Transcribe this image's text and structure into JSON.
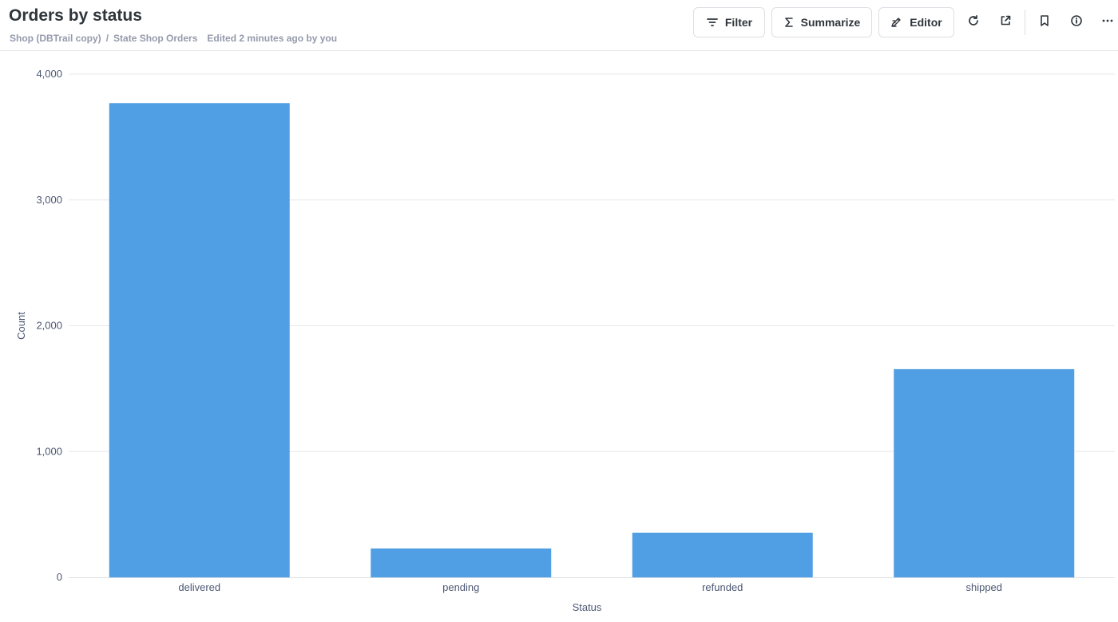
{
  "header": {
    "title": "Orders by status",
    "breadcrumbs": [
      "Shop (DBTrail copy)",
      "State Shop Orders"
    ],
    "breadcrumb_separator": "/",
    "edited": "Edited 2 minutes ago by you"
  },
  "toolbar": {
    "filter_label": "Filter",
    "summarize_label": "Summarize",
    "editor_label": "Editor",
    "icons": [
      "filter-icon",
      "sigma-icon",
      "notebook-icon",
      "refresh-icon",
      "share-icon",
      "bookmark-icon",
      "info-icon",
      "more-icon"
    ]
  },
  "colors": {
    "bar": "#509ee3",
    "grid": "#e6e8eb",
    "text": "#4c5773",
    "title": "#2e353b"
  },
  "chart_data": {
    "type": "bar",
    "categories": [
      "delivered",
      "pending",
      "refunded",
      "shipped"
    ],
    "values": [
      3770,
      230,
      355,
      1655
    ],
    "xlabel": "Status",
    "ylabel": "Count",
    "ylim": [
      0,
      4000
    ],
    "yticks": [
      0,
      1000,
      2000,
      3000,
      4000
    ],
    "ytick_labels": [
      "0",
      "1,000",
      "2,000",
      "3,000",
      "4,000"
    ],
    "grid": true
  }
}
